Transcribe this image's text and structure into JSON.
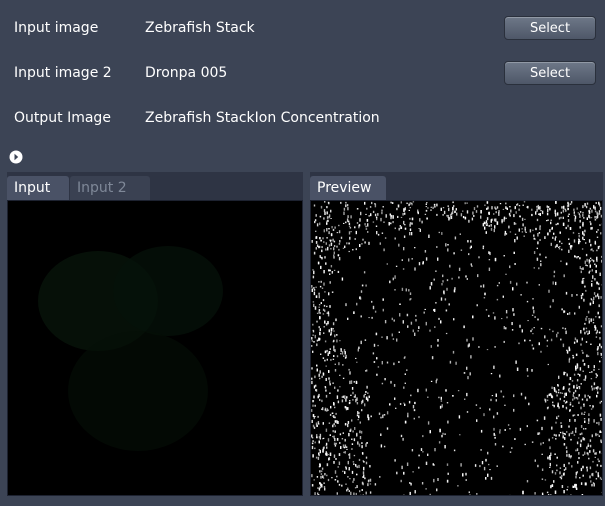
{
  "rows": [
    {
      "label": "Input image",
      "value": "Zebrafish Stack",
      "button": "Select"
    },
    {
      "label": "Input image 2",
      "value": "Dronpa 005",
      "button": "Select"
    },
    {
      "label": "Output Image",
      "value": "Zebrafish StackIon Concentration"
    }
  ],
  "left_panel": {
    "tabs": [
      {
        "label": "Input",
        "active": true
      },
      {
        "label": "Input 2",
        "active": false
      }
    ]
  },
  "right_panel": {
    "tabs": [
      {
        "label": "Preview",
        "active": true
      }
    ]
  },
  "colors": {
    "background": "#3c4455",
    "tab_active": "#4a5266",
    "tab_inactive_text": "#7f8898",
    "input_image_tint": "#0b1a08"
  },
  "icons": {
    "expander": "circle-arrow-right-icon"
  }
}
